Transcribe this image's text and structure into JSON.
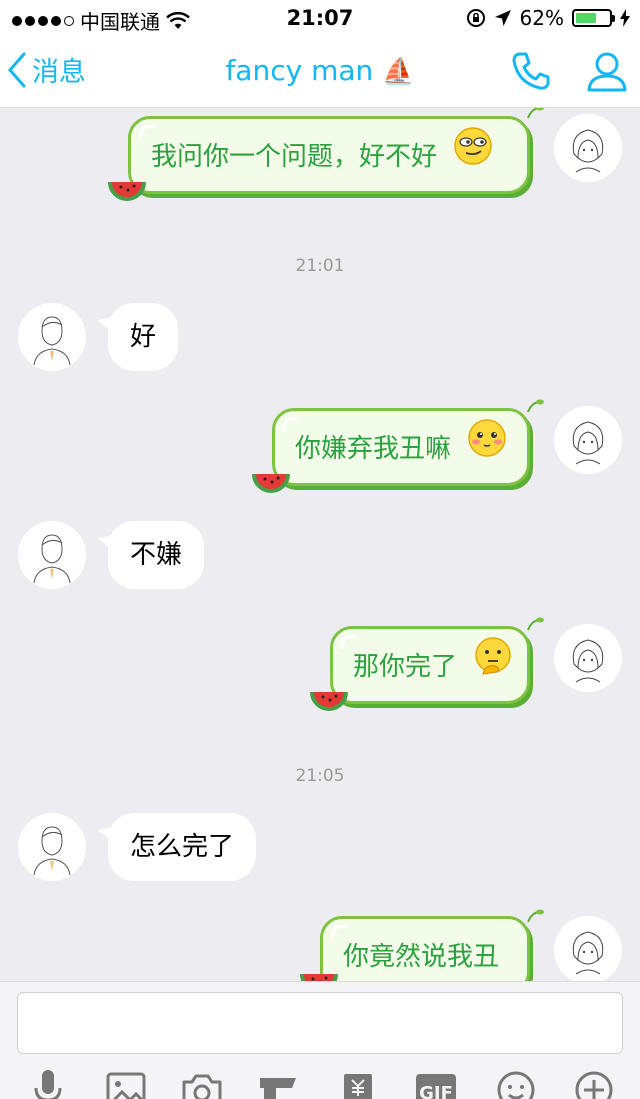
{
  "status_bar": {
    "carrier": "中国联通",
    "time": "21:07",
    "battery": "62%",
    "battery_level": 0.62
  },
  "nav": {
    "back_label": "消息",
    "title": "fancy man",
    "title_emoji": "⛵"
  },
  "messages": [
    {
      "dir": "out",
      "text": "我问你一个问题，好不好",
      "emoji": "smirk-emoji"
    },
    {
      "timestamp": "21:01"
    },
    {
      "dir": "in",
      "text": "好"
    },
    {
      "dir": "out",
      "text": "你嫌弃我丑嘛",
      "emoji": "shy-emoji"
    },
    {
      "dir": "in",
      "text": "不嫌"
    },
    {
      "dir": "out",
      "text": "那你完了",
      "emoji": "thinking-emoji"
    },
    {
      "timestamp": "21:05"
    },
    {
      "dir": "in",
      "text": "怎么完了"
    },
    {
      "dir": "out",
      "text": "你竟然说我丑"
    }
  ],
  "input": {
    "placeholder": ""
  },
  "toolbar": [
    "microphone-icon",
    "image-icon",
    "camera-icon",
    "red-packet-icon",
    "money-icon",
    "gif-icon",
    "emoji-icon",
    "plus-icon"
  ],
  "toolbar_gif_label": "GIF",
  "colors": {
    "accent": "#12b7f5",
    "bubble_out_text": "#2aa23d",
    "bubble_out_border": "#7ec33f",
    "background": "#ececf1"
  }
}
